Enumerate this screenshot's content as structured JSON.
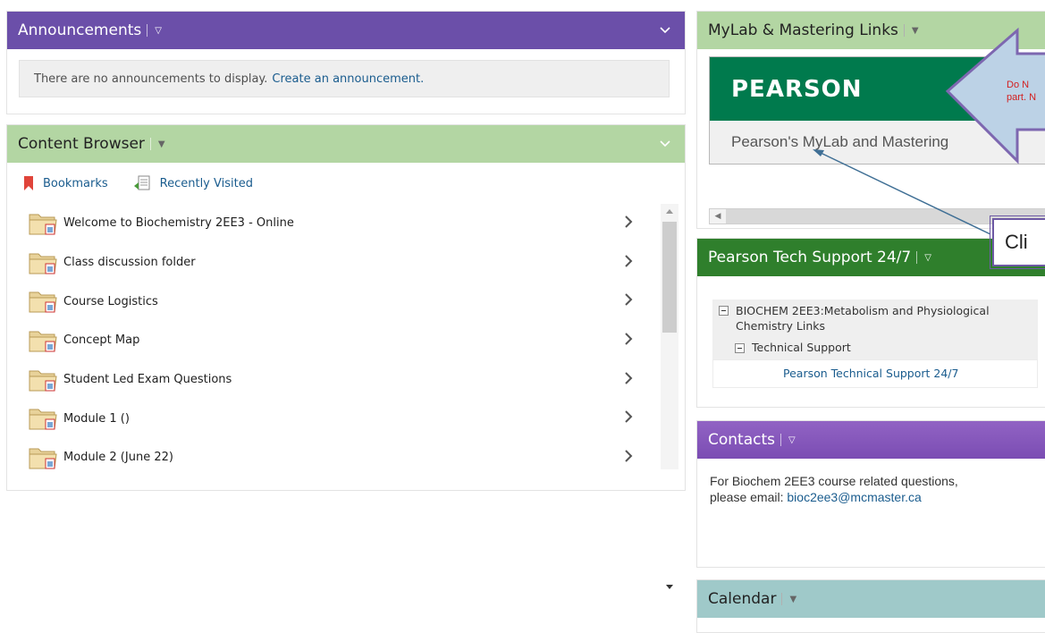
{
  "announcements": {
    "title": "Announcements",
    "message": "There are no announcements to display.",
    "create_link": "Create an announcement."
  },
  "content_browser": {
    "title": "Content Browser",
    "tabs": [
      {
        "label": "Bookmarks",
        "icon": "bookmark-icon"
      },
      {
        "label": "Recently Visited",
        "icon": "recently-visited-icon"
      }
    ],
    "items": [
      {
        "label": "Welcome to Biochemistry 2EE3 - Online"
      },
      {
        "label": "Class discussion folder"
      },
      {
        "label": "Course Logistics"
      },
      {
        "label": "Concept Map"
      },
      {
        "label": "Student Led Exam Questions"
      },
      {
        "label": "Module 1 ()"
      },
      {
        "label": "Module 2 (June 22)"
      }
    ]
  },
  "mylab": {
    "title": "MyLab & Mastering Links",
    "banner_text": "PEARSON",
    "caption": "Pearson's MyLab and Mastering"
  },
  "tech_support": {
    "title": "Pearson Tech Support 24/7",
    "tree_root_line1": "BIOCHEM 2EE3:Metabolism and Physiological",
    "tree_root_line2": "Chemistry Links",
    "tree_child": "Technical Support",
    "link": "Pearson Technical Support 24/7"
  },
  "contacts": {
    "title": "Contacts",
    "line1": "For Biochem 2EE3 course related questions,",
    "line2_prefix": "please email: ",
    "email": "bioc2ee3@mcmaster.ca"
  },
  "calendar": {
    "title": "Calendar"
  },
  "annotations": {
    "arrow_text_line1": "Do N",
    "arrow_text_line2": "part. N",
    "callout_text": "Cli"
  },
  "colors": {
    "announcements_header": "#6b4fa9",
    "content_browser_header": "#b3d6a3",
    "tech_support_header": "#2f7f2c",
    "contacts_header": "#7b4db3",
    "calendar_header": "#9fc9c9",
    "pearson_green": "#007a4d",
    "link_blue": "#1a5c8e",
    "annotation_red": "#d31f1f",
    "annotation_purple": "#6e5aa4"
  }
}
